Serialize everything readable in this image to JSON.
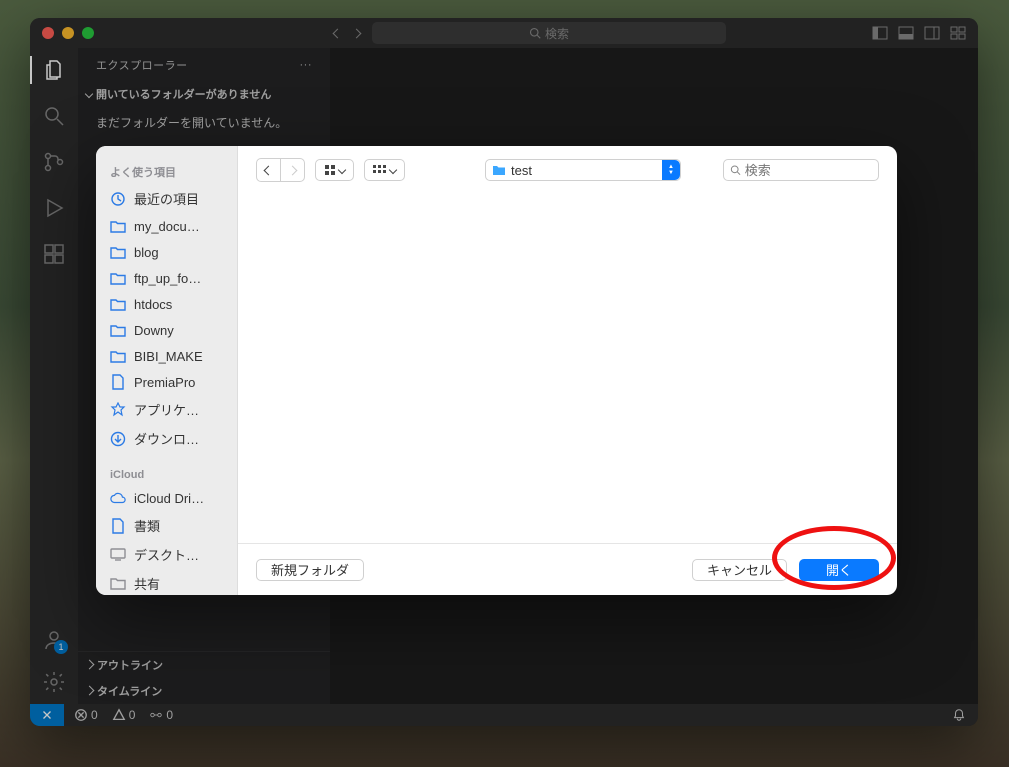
{
  "titlebar": {
    "search_placeholder": "検索"
  },
  "activity": {
    "account_badge": "1"
  },
  "explorer": {
    "title": "エクスプローラー",
    "section": "開いているフォルダーがありません",
    "body_text": "まだフォルダーを開いていません。",
    "outline": "アウトライン",
    "timeline": "タイムライン"
  },
  "statusbar": {
    "errors": "0",
    "warnings": "0",
    "ports": "0"
  },
  "dialog": {
    "sidebar": {
      "favorites_label": "よく使う項目",
      "favorites": [
        {
          "icon": "clock",
          "label": "最近の項目"
        },
        {
          "icon": "folder",
          "label": "my_docu…"
        },
        {
          "icon": "folder",
          "label": "blog"
        },
        {
          "icon": "folder",
          "label": "ftp_up_fo…"
        },
        {
          "icon": "folder",
          "label": "htdocs"
        },
        {
          "icon": "folder",
          "label": "Downy"
        },
        {
          "icon": "folder",
          "label": "BIBI_MAKE"
        },
        {
          "icon": "doc",
          "label": "PremiaPro"
        },
        {
          "icon": "app",
          "label": "アプリケ…"
        },
        {
          "icon": "download",
          "label": "ダウンロ…"
        }
      ],
      "icloud_label": "iCloud",
      "icloud": [
        {
          "icon": "cloud",
          "label": "iCloud Dri…"
        },
        {
          "icon": "doc",
          "label": "書類"
        },
        {
          "icon": "desktop",
          "label": "デスクト…"
        },
        {
          "icon": "shared",
          "label": "共有"
        }
      ]
    },
    "path": "test",
    "search_placeholder": "検索",
    "new_folder": "新規フォルダ",
    "cancel": "キャンセル",
    "open": "開く"
  }
}
